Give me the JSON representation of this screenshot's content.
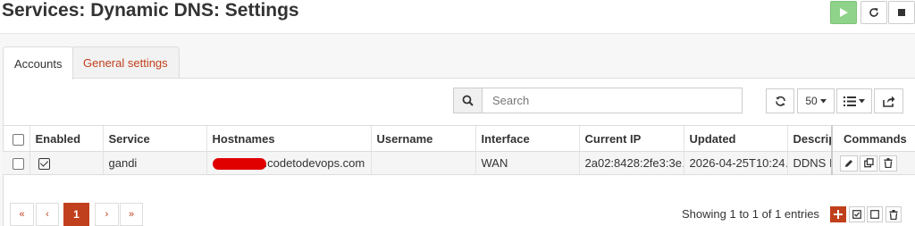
{
  "page": {
    "title": "Services: Dynamic DNS: Settings"
  },
  "service_controls": {
    "play": "play-icon",
    "restart": "restart-icon",
    "stop": "stop-icon"
  },
  "tabs": [
    {
      "label": "Accounts",
      "active": true
    },
    {
      "label": "General settings",
      "active": false
    }
  ],
  "toolbar": {
    "search_placeholder": "Search",
    "page_size": "50",
    "icons": [
      "refresh-icon",
      "columns-list-icon",
      "export-icon"
    ]
  },
  "table": {
    "columns": [
      "Enabled",
      "Service",
      "Hostnames",
      "Username",
      "Interface",
      "Current IP",
      "Updated",
      "Descript",
      "Commands"
    ],
    "rows": [
      {
        "enabled": true,
        "service": "gandi",
        "hostname": ".codetodevops.com",
        "username": "",
        "interface": "WAN",
        "current_ip": "2a02:8428:2fe3:3e…",
        "updated": "2026-04-25T10:24…",
        "description": "DDNS IPv"
      }
    ]
  },
  "pagination": {
    "first": "«",
    "prev": "‹",
    "current": "1",
    "next": "›",
    "last": "»"
  },
  "footer": {
    "entries_text": "Showing 1 to 1 of 1 entries"
  },
  "colors": {
    "accent": "#c0401d",
    "play": "#8fd38a",
    "redaction": "#e00000"
  }
}
